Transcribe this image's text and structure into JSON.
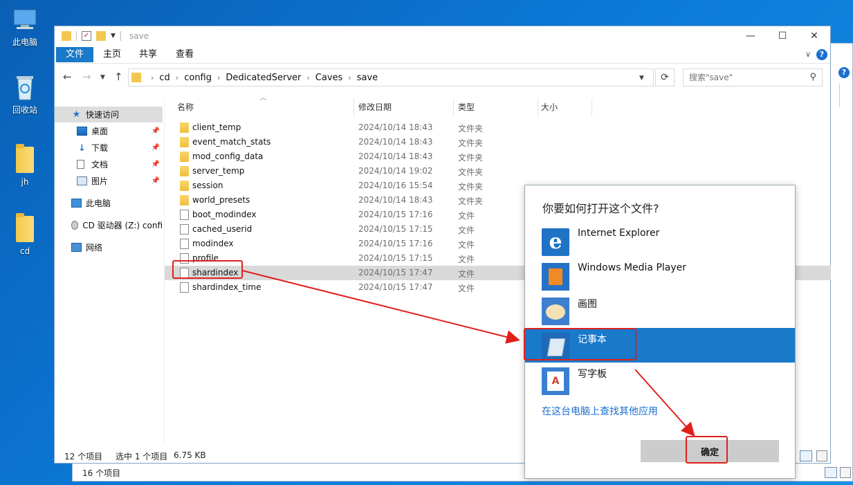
{
  "desktop": {
    "icons": [
      {
        "label": "此电脑",
        "icon": "computer-icon"
      },
      {
        "label": "回收站",
        "icon": "recycle-bin-icon"
      },
      {
        "label": "jh",
        "icon": "folder-icon"
      },
      {
        "label": "cd",
        "icon": "folder-icon"
      }
    ]
  },
  "back_window": {
    "status": "16 个项目"
  },
  "window": {
    "title": "save",
    "ribbon_tabs": [
      "文件",
      "主页",
      "共享",
      "查看"
    ],
    "breadcrumb": [
      "cd",
      "config",
      "DedicatedServer",
      "Caves",
      "save"
    ],
    "search_placeholder": "搜索\"save\"",
    "sidebar": [
      {
        "label": "快速访问",
        "icon": "star-icon",
        "pinned": false
      },
      {
        "label": "桌面",
        "icon": "desktop-icon",
        "pinned": true
      },
      {
        "label": "下载",
        "icon": "download-icon",
        "pinned": true
      },
      {
        "label": "文档",
        "icon": "document-icon",
        "pinned": true
      },
      {
        "label": "图片",
        "icon": "pictures-icon",
        "pinned": true
      },
      {
        "label": "此电脑",
        "icon": "computer-icon",
        "pinned": false
      },
      {
        "label": "CD 驱动器 (Z:) confi",
        "icon": "cd-drive-icon",
        "pinned": false
      },
      {
        "label": "网络",
        "icon": "network-icon",
        "pinned": false
      }
    ],
    "columns": [
      "名称",
      "修改日期",
      "类型",
      "大小"
    ],
    "files": [
      {
        "name": "client_temp",
        "date": "2024/10/14 18:43",
        "type": "文件夹",
        "kind": "folder"
      },
      {
        "name": "event_match_stats",
        "date": "2024/10/14 18:43",
        "type": "文件夹",
        "kind": "folder"
      },
      {
        "name": "mod_config_data",
        "date": "2024/10/14 18:43",
        "type": "文件夹",
        "kind": "folder"
      },
      {
        "name": "server_temp",
        "date": "2024/10/14 19:02",
        "type": "文件夹",
        "kind": "folder"
      },
      {
        "name": "session",
        "date": "2024/10/16 15:54",
        "type": "文件夹",
        "kind": "folder"
      },
      {
        "name": "world_presets",
        "date": "2024/10/14 18:43",
        "type": "文件夹",
        "kind": "folder"
      },
      {
        "name": "boot_modindex",
        "date": "2024/10/15 17:16",
        "type": "文件",
        "kind": "file"
      },
      {
        "name": "cached_userid",
        "date": "2024/10/15 17:15",
        "type": "文件",
        "kind": "file"
      },
      {
        "name": "modindex",
        "date": "2024/10/15 17:16",
        "type": "文件",
        "kind": "file"
      },
      {
        "name": "profile",
        "date": "2024/10/15 17:15",
        "type": "文件",
        "kind": "file"
      },
      {
        "name": "shardindex",
        "date": "2024/10/15 17:47",
        "type": "文件",
        "kind": "file"
      },
      {
        "name": "shardindex_time",
        "date": "2024/10/15 17:47",
        "type": "文件",
        "kind": "file"
      }
    ],
    "status": {
      "count": "12 个项目",
      "selected": "选中 1 个项目",
      "size": "6.75 KB"
    }
  },
  "dialog": {
    "title": "你要如何打开这个文件?",
    "apps": [
      {
        "name": "Internet Explorer",
        "icon": "internet-explorer-icon"
      },
      {
        "name": "Windows Media Player",
        "icon": "media-player-icon"
      },
      {
        "name": "画图",
        "icon": "paint-icon"
      },
      {
        "name": "记事本",
        "icon": "notepad-icon"
      },
      {
        "name": "写字板",
        "icon": "wordpad-icon"
      }
    ],
    "more_link": "在这台电脑上查找其他应用",
    "ok_label": "确定"
  },
  "colors": {
    "accent": "#1979ca",
    "annotation": "#e0201b",
    "selected_row": "#d9d9d9"
  }
}
